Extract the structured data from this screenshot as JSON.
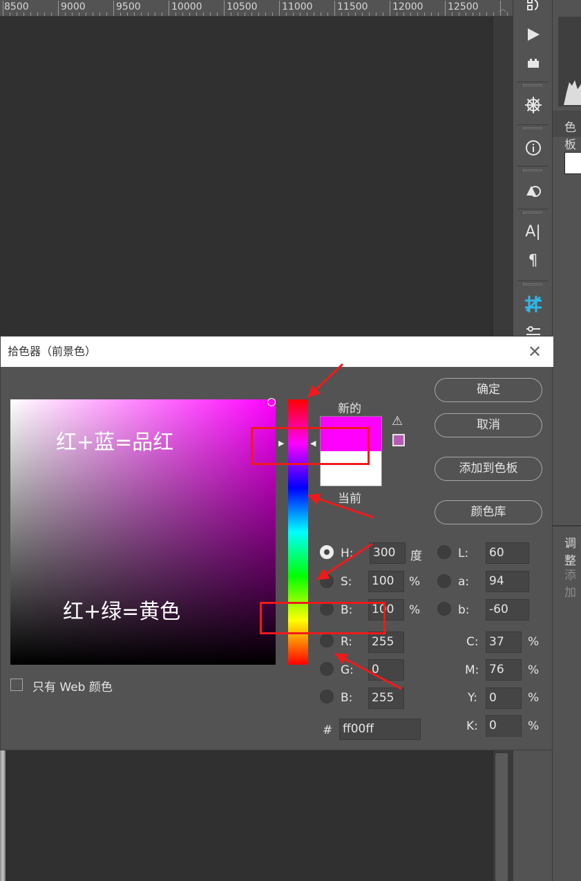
{
  "ruler": {
    "labels": [
      "8500",
      "9000",
      "9500",
      "10000",
      "10500",
      "11000",
      "11500",
      "12000",
      "12500"
    ]
  },
  "colors": {
    "accent_red": "#f01a1a",
    "new_color": "#ff00ff",
    "current_color": "#ffffff",
    "gamut_swatch": "#b45cb4"
  },
  "tools": [
    "rotate-history-icon",
    "play-icon",
    "plugin-icon",
    "wheel-icon",
    "info-icon",
    "shapes-icon",
    "text-tool-icon",
    "paragraph-icon",
    "grid-icon",
    "adjust-icon"
  ],
  "tools_text": {
    "text_tool": "A|",
    "paragraph": "¶"
  },
  "right_panel": {
    "tab1": "色板",
    "tab2": "调整",
    "hint": "添加"
  },
  "dialog": {
    "title": "拾色器（前景色）",
    "close": "✕",
    "annotations": {
      "top": "红+蓝=品红",
      "bottom": "红+绿=黄色"
    },
    "new_label": "新的",
    "current_label": "当前",
    "warning": "⚠",
    "buttons": {
      "ok": "确定",
      "cancel": "取消",
      "add_swatch": "添加到色板",
      "color_library": "颜色库"
    },
    "hsb": [
      {
        "label": "H:",
        "value": "300",
        "unit": "度"
      },
      {
        "label": "S:",
        "value": "100",
        "unit": "%"
      },
      {
        "label": "B:",
        "value": "100",
        "unit": "%"
      }
    ],
    "rgb": [
      {
        "label": "R:",
        "value": "255"
      },
      {
        "label": "G:",
        "value": "0"
      },
      {
        "label": "B:",
        "value": "255"
      }
    ],
    "lab": [
      {
        "label": "L:",
        "value": "60"
      },
      {
        "label": "a:",
        "value": "94"
      },
      {
        "label": "b:",
        "value": "-60"
      }
    ],
    "cmyk": [
      {
        "label": "C:",
        "value": "37",
        "unit": "%"
      },
      {
        "label": "M:",
        "value": "76",
        "unit": "%"
      },
      {
        "label": "Y:",
        "value": "0",
        "unit": "%"
      },
      {
        "label": "K:",
        "value": "0",
        "unit": "%"
      }
    ],
    "hex_label": "#",
    "hex_value": "ff00ff",
    "web_only": "只有 Web 颜色",
    "hue_degrees": 300
  }
}
